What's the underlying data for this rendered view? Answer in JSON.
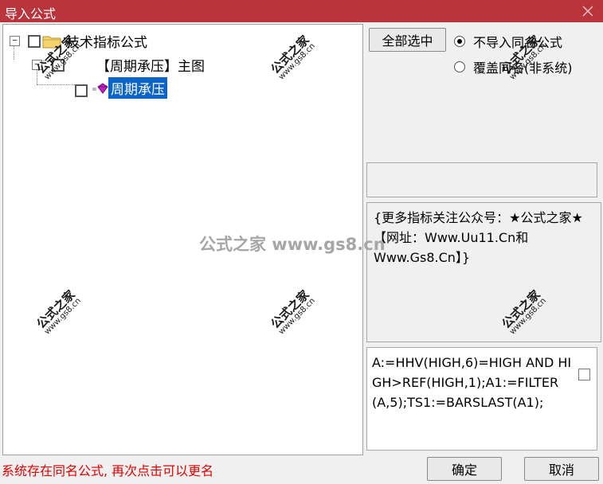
{
  "window": {
    "title": "导入公式",
    "close_glyph": "✕"
  },
  "tree": {
    "root": {
      "expander": "−",
      "label": "技术指标公式",
      "icon": "folder-icon"
    },
    "group": {
      "expander": "−",
      "label": "【周期承压】主图"
    },
    "leaf": {
      "label": "周期承压",
      "icon": "formula-cube-icon"
    }
  },
  "options": {
    "select_all_label": "全部选中",
    "radio_no_import_label": "不导入同名公式",
    "radio_overwrite_label": "覆盖同名(非系统)",
    "selected_radio": "no_import"
  },
  "description": "{更多指标关注公众号：★公式之家★【网址：Www.Uu11.Cn和Www.Gs8.Cn】}",
  "code": "A:=HHV(HIGH,6)=HIGH AND HIGH>REF(HIGH,1);A1:=FILTER(A,5);TS1:=BARSLAST(A1);",
  "status": "系统存在同名公式, 再次点击可以更名",
  "buttons": {
    "ok": "确定",
    "cancel": "取消"
  },
  "watermark": {
    "main": "公式之家",
    "url": "www.gs8.cn",
    "center": "公式之家 www.gs8.cn"
  },
  "colors": {
    "titlebar": "#b8353c",
    "selection": "#0a64c8",
    "status": "#e00000"
  }
}
